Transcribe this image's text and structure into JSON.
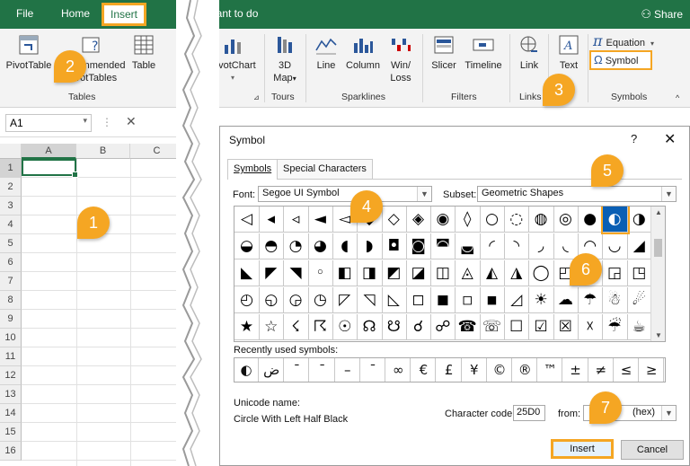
{
  "ribbon_tabs": {
    "file": "File",
    "home": "Home",
    "insert": "Insert",
    "tell_me": "want to do",
    "share": "Share"
  },
  "ribbon": {
    "pivottable": "PivotTable",
    "recommended_line1": "mmended",
    "recommended_line2": "PivotTables",
    "table": "Table",
    "tables_group": "Tables",
    "pivotchart": "PivotChart",
    "map_line1": "3D",
    "map_line2": "Map",
    "tours_group": "Tours",
    "line": "Line",
    "column": "Column",
    "winloss_line1": "Win/",
    "winloss_line2": "Loss",
    "sparklines_group": "Sparklines",
    "slicer": "Slicer",
    "timeline": "Timeline",
    "filters_group": "Filters",
    "link": "Link",
    "links_group": "Links",
    "text": "Text",
    "equation": "Equation",
    "symbol": "Symbol",
    "symbols_group": "Symbols"
  },
  "sheet": {
    "namebox": "A1",
    "fx_dots": "⋮",
    "fx_x": "✕",
    "columns": [
      "A",
      "B",
      "C"
    ],
    "rows": [
      "1",
      "2",
      "3",
      "4",
      "5",
      "6",
      "7",
      "8",
      "9",
      "10",
      "11",
      "12",
      "13",
      "14",
      "15",
      "16"
    ]
  },
  "dialog": {
    "title": "Symbol",
    "help": "?",
    "close": "✕",
    "tab_symbols": "Symbols",
    "tab_special": "Special Characters",
    "font_label": "Font:",
    "font_value": "Segoe UI Symbol",
    "subset_label": "Subset:",
    "subset_value": "Geometric Shapes",
    "symbol_rows": [
      [
        "◁",
        "◂",
        "◃",
        "◄",
        "◅",
        "◆",
        "◇",
        "◈",
        "◉",
        "◊",
        "○",
        "◌",
        "◍",
        "◎",
        "●",
        "◐",
        "◑"
      ],
      [
        "◒",
        "◓",
        "◔",
        "◕",
        "◖",
        "◗",
        "◘",
        "◙",
        "◚",
        "◛",
        "◜",
        "◝",
        "◞",
        "◟",
        "◠",
        "◡",
        "◢"
      ],
      [
        "◣",
        "◤",
        "◥",
        "◦",
        "◧",
        "◨",
        "◩",
        "◪",
        "◫",
        "◬",
        "◭",
        "◮",
        "◯",
        "◰",
        "◱",
        "◲",
        "◳"
      ],
      [
        "◴",
        "◵",
        "◶",
        "◷",
        "◸",
        "◹",
        "◺",
        "◻",
        "◼",
        "◽",
        "◾",
        "◿",
        "☀",
        "☁",
        "☂",
        "☃",
        "☄"
      ],
      [
        "★",
        "☆",
        "☇",
        "☈",
        "☉",
        "☊",
        "☋",
        "☌",
        "☍",
        "☎",
        "☏",
        "☐",
        "☑",
        "☒",
        "☓",
        "☔",
        "☕"
      ]
    ],
    "selected_symbol": "◐",
    "recent_label": "Recently used symbols:",
    "recent_symbols": [
      "◐",
      "ض",
      "¯",
      "¯",
      "–",
      "¯",
      "∞",
      "€",
      "£",
      "¥",
      "©",
      "®",
      "™",
      "±",
      "≠",
      "≤",
      "≥"
    ],
    "unicode_label": "Unicode name:",
    "unicode_name": "Circle With Left Half Black",
    "charcode_label": "Character code:",
    "charcode_value": "25D0",
    "from_label": "from:",
    "from_value": "(hex)",
    "insert_button": "Insert",
    "cancel_button": "Cancel"
  },
  "callouts": [
    "1",
    "2",
    "3",
    "4",
    "5",
    "6",
    "7"
  ],
  "colors": {
    "excel_green": "#217346",
    "highlight_orange": "#f5a623",
    "selection_blue": "#0a5fb4"
  }
}
